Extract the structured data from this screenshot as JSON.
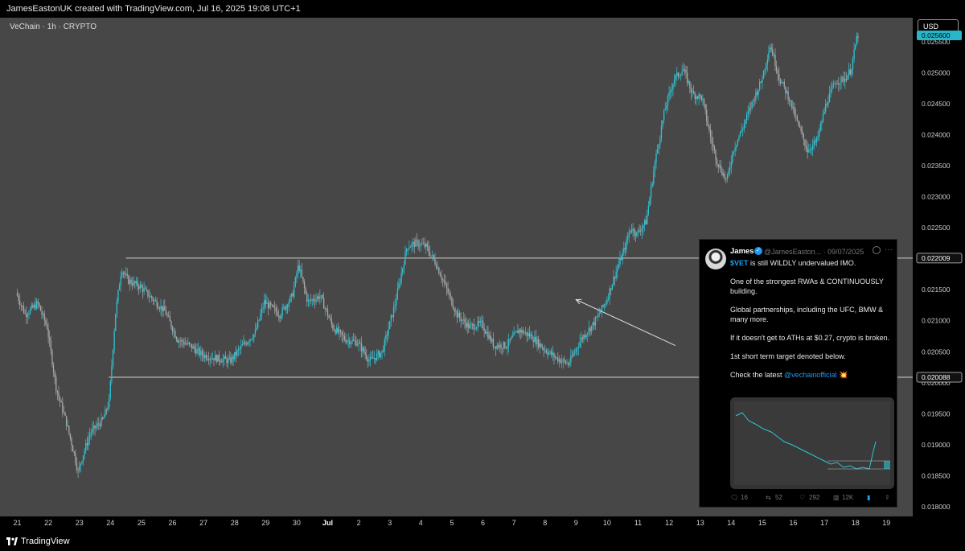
{
  "header": {
    "credit": "JamesEastonUK created with TradingView.com, Jul 16, 2025 19:08 UTC+1"
  },
  "symbol": {
    "label": "VeChain · 1h · CRYPTO"
  },
  "currency": {
    "label": "USD"
  },
  "footer": {
    "brand": "TradingView"
  },
  "colors": {
    "bull": "#2ec4d6",
    "bear": "#a9a9a9",
    "background": "#474747",
    "level_line": "#d0d0d0",
    "current_tag": "#29b6c9"
  },
  "chart_data": {
    "type": "candlestick",
    "interval": "1h",
    "x_tick_labels": [
      "21",
      "22",
      "23",
      "24",
      "25",
      "26",
      "27",
      "28",
      "29",
      "30",
      "Jul",
      "2",
      "3",
      "4",
      "5",
      "6",
      "7",
      "8",
      "9",
      "10",
      "11",
      "12",
      "13",
      "14",
      "15",
      "16",
      "17",
      "18",
      "19"
    ],
    "y_tick_labels": [
      "0.025500",
      "0.025000",
      "0.024500",
      "0.024000",
      "0.023500",
      "0.023000",
      "0.022500",
      "0.022000",
      "0.021500",
      "0.021000",
      "0.020500",
      "0.020000",
      "0.019500",
      "0.019000",
      "0.018500",
      "0.018000"
    ],
    "ylim": [
      0.01795,
      0.02574
    ],
    "price_path": [
      [
        0,
        0.02145
      ],
      [
        0.3,
        0.0211
      ],
      [
        0.7,
        0.02128
      ],
      [
        1.0,
        0.0209
      ],
      [
        1.3,
        0.0199
      ],
      [
        1.6,
        0.0194
      ],
      [
        1.9,
        0.0188
      ],
      [
        2.0,
        0.01855
      ],
      [
        2.1,
        0.01875
      ],
      [
        2.4,
        0.0192
      ],
      [
        2.8,
        0.0194
      ],
      [
        3.0,
        0.0197
      ],
      [
        3.2,
        0.0211
      ],
      [
        3.4,
        0.02185
      ],
      [
        3.6,
        0.02165
      ],
      [
        4.0,
        0.02155
      ],
      [
        4.4,
        0.02135
      ],
      [
        4.8,
        0.02115
      ],
      [
        5.2,
        0.0207
      ],
      [
        5.6,
        0.0206
      ],
      [
        6.0,
        0.02045
      ],
      [
        6.4,
        0.0204
      ],
      [
        6.9,
        0.02035
      ],
      [
        7.3,
        0.0206
      ],
      [
        7.7,
        0.0208
      ],
      [
        8.0,
        0.0213
      ],
      [
        8.5,
        0.0211
      ],
      [
        8.9,
        0.0214
      ],
      [
        9.1,
        0.0219
      ],
      [
        9.4,
        0.0213
      ],
      [
        9.8,
        0.0214
      ],
      [
        10.2,
        0.0209
      ],
      [
        10.6,
        0.0207
      ],
      [
        11.0,
        0.02065
      ],
      [
        11.4,
        0.02035
      ],
      [
        11.8,
        0.0205
      ],
      [
        12.2,
        0.02125
      ],
      [
        12.6,
        0.0222
      ],
      [
        12.9,
        0.02225
      ],
      [
        13.2,
        0.0222
      ],
      [
        13.5,
        0.02195
      ],
      [
        13.8,
        0.0216
      ],
      [
        14.2,
        0.0211
      ],
      [
        14.6,
        0.0209
      ],
      [
        15.0,
        0.02095
      ],
      [
        15.4,
        0.0206
      ],
      [
        15.8,
        0.0206
      ],
      [
        16.2,
        0.02085
      ],
      [
        16.6,
        0.02075
      ],
      [
        17.0,
        0.02055
      ],
      [
        17.4,
        0.0204
      ],
      [
        17.8,
        0.0203
      ],
      [
        18.2,
        0.0207
      ],
      [
        18.6,
        0.02095
      ],
      [
        19.0,
        0.0213
      ],
      [
        19.3,
        0.02175
      ],
      [
        19.6,
        0.02215
      ],
      [
        19.8,
        0.0225
      ],
      [
        20.0,
        0.0224
      ],
      [
        20.3,
        0.0226
      ],
      [
        20.6,
        0.0236
      ],
      [
        20.9,
        0.0244
      ],
      [
        21.2,
        0.0249
      ],
      [
        21.5,
        0.02505
      ],
      [
        21.8,
        0.02465
      ],
      [
        22.1,
        0.0246
      ],
      [
        22.4,
        0.0239
      ],
      [
        22.6,
        0.02355
      ],
      [
        22.9,
        0.02325
      ],
      [
        23.1,
        0.02375
      ],
      [
        23.4,
        0.0241
      ],
      [
        23.7,
        0.0245
      ],
      [
        24.0,
        0.02485
      ],
      [
        24.3,
        0.02545
      ],
      [
        24.6,
        0.0249
      ],
      [
        24.9,
        0.0246
      ],
      [
        25.2,
        0.02415
      ],
      [
        25.5,
        0.02375
      ],
      [
        25.8,
        0.0239
      ],
      [
        26.1,
        0.0245
      ],
      [
        26.4,
        0.02485
      ],
      [
        26.7,
        0.0249
      ],
      [
        26.9,
        0.02505
      ],
      [
        27.1,
        0.0256
      ]
    ],
    "levels": [
      {
        "label": "0.022009",
        "value": 0.022009,
        "from_day": 3.5
      },
      {
        "label": "0.020088",
        "value": 0.020088,
        "from_day": 2.95
      }
    ],
    "current_price": {
      "label": "0.025600",
      "value": 0.0256
    },
    "annotations": [
      {
        "type": "arrow",
        "from_day": 21.2,
        "from_price": 0.0206,
        "to_day": 18.0,
        "to_price": 0.02134
      }
    ]
  },
  "tweet": {
    "name": "James",
    "handle": "@JamesEaston... · 09/07/2025",
    "cashtag": "$VET",
    "line1_rest": " is still WILDLY undervalued IMO.",
    "p2": "One of the strongest RWAs & CONTINUOUSLY building.",
    "p3": "Global partnerships, including the UFC, BMW & many more.",
    "p4": "If it doesn't get to ATHs at $0.27, crypto is broken.",
    "p5": "1st short term target denoted below.",
    "p6_text": "Check the latest ",
    "p6_mention": "@vechainofficial",
    "p6_emoji": "💥",
    "stats": {
      "replies": "16",
      "reposts": "52",
      "likes": "292",
      "views": "12K"
    }
  }
}
